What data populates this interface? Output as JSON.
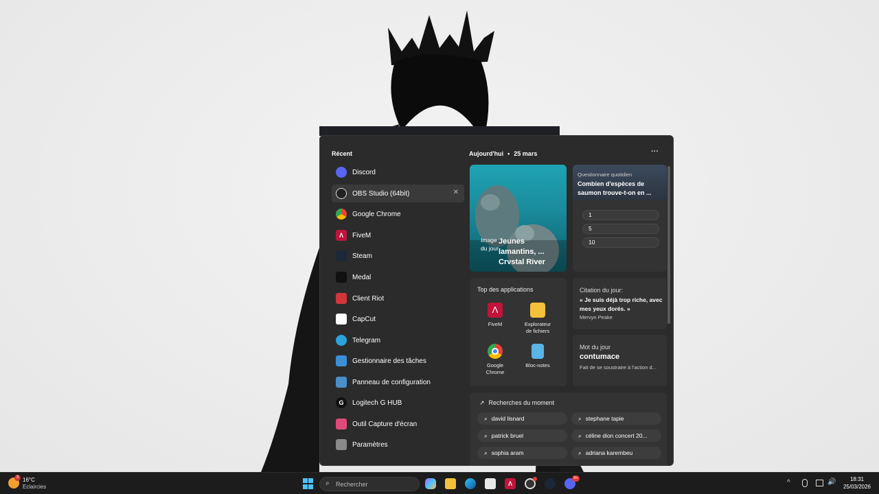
{
  "recent": {
    "title": "Récent",
    "items": [
      {
        "label": "Discord",
        "icon": "discord-icon",
        "color": "#5865f2"
      },
      {
        "label": "OBS Studio (64bit)",
        "icon": "obs-icon",
        "color": "#222222"
      },
      {
        "label": "Google Chrome",
        "icon": "chrome-icon",
        "color": "#ffffff"
      },
      {
        "label": "FiveM",
        "icon": "fivem-icon",
        "color": "#c0143c"
      },
      {
        "label": "Steam",
        "icon": "steam-icon",
        "color": "#1b2838"
      },
      {
        "label": "Medal",
        "icon": "medal-icon",
        "color": "#111111"
      },
      {
        "label": "Client Riot",
        "icon": "riot-icon",
        "color": "#d13639"
      },
      {
        "label": "CapCut",
        "icon": "capcut-icon",
        "color": "#ffffff"
      },
      {
        "label": "Telegram",
        "icon": "telegram-icon",
        "color": "#2aa3dd"
      },
      {
        "label": "Gestionnaire des tâches",
        "icon": "task-manager-icon",
        "color": "#3b8fd6"
      },
      {
        "label": "Panneau de configuration",
        "icon": "control-panel-icon",
        "color": "#4a90c8"
      },
      {
        "label": "Logitech G HUB",
        "icon": "logitech-icon",
        "color": "#111111"
      },
      {
        "label": "Outil Capture d'écran",
        "icon": "snipping-tool-icon",
        "color": "#e04a7a"
      },
      {
        "label": "Paramètres",
        "icon": "settings-icon",
        "color": "#8a8a8a"
      }
    ]
  },
  "today": {
    "label": "Aujourd'hui",
    "separator": "•",
    "date": "25 mars",
    "more": "···"
  },
  "image_card": {
    "tag": "Image du jour",
    "title": "Jeunes lamantins, ... Crystal River"
  },
  "quiz": {
    "label": "Questionnaire quotidien",
    "question": "Combien d'espèces de saumon trouve-t-on en ...",
    "options": [
      "1",
      "5",
      "10"
    ]
  },
  "top_apps": {
    "title": "Top des applications",
    "apps": [
      {
        "line1": "FiveM",
        "line2": "",
        "icon": "fivem-icon"
      },
      {
        "line1": "Explorateur",
        "line2": "de fichiers",
        "icon": "file-explorer-icon"
      },
      {
        "line1": "Google",
        "line2": "Chrome",
        "icon": "chrome-icon"
      },
      {
        "line1": "Bloc-notes",
        "line2": "",
        "icon": "notepad-icon"
      }
    ]
  },
  "quote": {
    "label": "Citation du jour:",
    "text": "« Je suis déjà trop riche, avec mes yeux dorés. »",
    "author": "Mervyn Peake"
  },
  "word": {
    "label": "Mot du jour",
    "word": "contumace",
    "definition": "Fait de se soustraire à l'action d..."
  },
  "trending": {
    "title": "Recherches du moment",
    "items": [
      "david lisnard",
      "stephane tapie",
      "patrick bruel",
      "céline dion concert 20...",
      "sophia aram",
      "adriana karembeu"
    ]
  },
  "taskbar": {
    "weather_temp": "16°C",
    "weather_desc": "Eclaircies",
    "weather_badge": "3",
    "search_placeholder": "Rechercher",
    "discord_badge": "9+",
    "time": "18:31",
    "date": "25/03/2026"
  },
  "colors": {
    "menu_bg": "#2b2b2b",
    "card_bg": "#333333",
    "taskbar_bg": "#1c1c1c",
    "accent": "#0078d4"
  }
}
